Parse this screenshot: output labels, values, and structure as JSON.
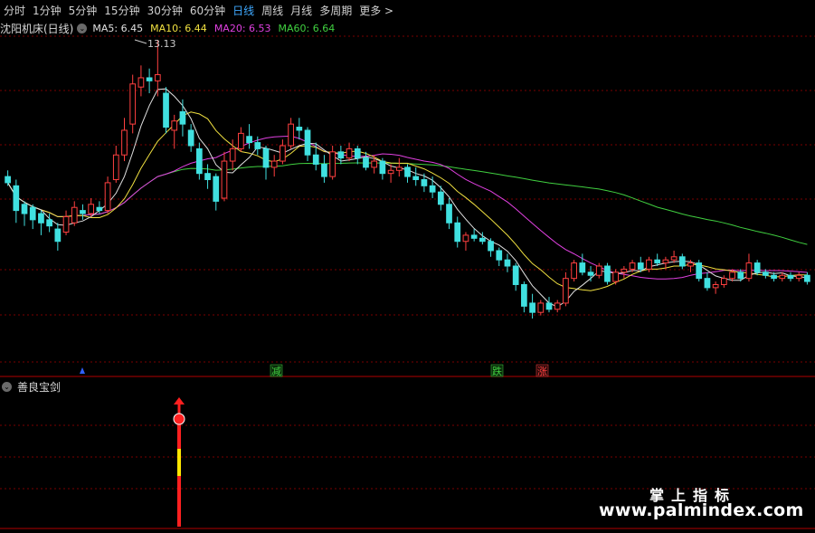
{
  "periods": [
    {
      "label": "分时"
    },
    {
      "label": "1分钟"
    },
    {
      "label": "5分钟"
    },
    {
      "label": "15分钟"
    },
    {
      "label": "30分钟"
    },
    {
      "label": "60分钟"
    },
    {
      "label": "日线"
    },
    {
      "label": "周线"
    },
    {
      "label": "月线"
    },
    {
      "label": "多周期"
    }
  ],
  "active_period": "日线",
  "more_label": "更多 >",
  "stock_title": "沈阳机床(日线)",
  "ma": [
    {
      "label": "MA5: 6.45",
      "color": "#e0e0e0"
    },
    {
      "label": "MA10: 6.44",
      "color": "#f0e040"
    },
    {
      "label": "MA20: 6.53",
      "color": "#e040e0"
    },
    {
      "label": "MA60: 6.64",
      "color": "#40d040"
    }
  ],
  "indicator_title": "善良宝剑",
  "max_price_label": "13.13",
  "signals": [
    {
      "text": "减",
      "color": "#40d040"
    },
    {
      "text": "跌",
      "color": "#40d040"
    },
    {
      "text": "涨",
      "color": "#ff4040"
    }
  ],
  "watermark_cn": "掌上指标",
  "watermark_url": "www.palmindex.com",
  "colors": {
    "up": "#ff4040",
    "down": "#40e0e0",
    "ma5": "#e0e0e0",
    "ma10": "#f0e040",
    "ma20": "#e040e0",
    "ma60": "#40d040",
    "grid": "#7a0000",
    "active": "#3fa9ff"
  },
  "chart_data": {
    "type": "candlestick",
    "ylim": [
      3,
      14
    ],
    "max_label_price": 13.13,
    "ma_last": {
      "MA5": 6.45,
      "MA10": 6.44,
      "MA20": 6.53,
      "MA60": 6.64
    },
    "candles": [
      [
        8.7,
        8.9,
        8.4,
        8.5
      ],
      [
        8.4,
        8.6,
        7.2,
        7.6
      ],
      [
        7.8,
        7.9,
        7.1,
        7.5
      ],
      [
        7.7,
        7.8,
        7.0,
        7.3
      ],
      [
        7.5,
        7.6,
        6.8,
        7.2
      ],
      [
        7.3,
        7.5,
        6.9,
        7.1
      ],
      [
        7.0,
        7.2,
        6.3,
        6.6
      ],
      [
        6.9,
        7.6,
        6.8,
        7.4
      ],
      [
        7.2,
        7.9,
        7.1,
        7.7
      ],
      [
        7.6,
        7.8,
        7.3,
        7.5
      ],
      [
        7.5,
        8.0,
        7.4,
        7.8
      ],
      [
        7.7,
        7.9,
        7.5,
        7.6
      ],
      [
        7.6,
        8.7,
        7.5,
        8.5
      ],
      [
        8.6,
        9.7,
        8.5,
        9.4
      ],
      [
        9.4,
        10.6,
        9.2,
        10.2
      ],
      [
        10.4,
        12.0,
        10.1,
        11.7
      ],
      [
        11.6,
        12.3,
        11.3,
        11.9
      ],
      [
        11.9,
        12.2,
        11.4,
        11.8
      ],
      [
        11.8,
        13.13,
        11.3,
        12.0
      ],
      [
        11.4,
        11.6,
        10.1,
        10.3
      ],
      [
        10.2,
        10.7,
        9.6,
        10.5
      ],
      [
        10.8,
        11.2,
        10.0,
        10.4
      ],
      [
        10.2,
        10.4,
        9.5,
        9.7
      ],
      [
        9.6,
        9.8,
        8.6,
        8.8
      ],
      [
        8.8,
        9.1,
        8.3,
        8.6
      ],
      [
        8.7,
        8.8,
        7.6,
        7.9
      ],
      [
        8.0,
        9.5,
        7.9,
        9.2
      ],
      [
        9.2,
        9.9,
        8.9,
        9.6
      ],
      [
        9.6,
        10.3,
        9.5,
        10.1
      ],
      [
        10.0,
        10.4,
        9.6,
        9.8
      ],
      [
        9.8,
        10.0,
        9.4,
        9.6
      ],
      [
        9.6,
        9.7,
        8.6,
        9.0
      ],
      [
        9.0,
        9.4,
        8.7,
        9.2
      ],
      [
        9.2,
        9.9,
        9.1,
        9.7
      ],
      [
        9.7,
        10.6,
        9.6,
        10.4
      ],
      [
        10.3,
        10.6,
        9.9,
        10.2
      ],
      [
        10.2,
        10.3,
        9.2,
        9.4
      ],
      [
        9.4,
        9.8,
        8.9,
        9.1
      ],
      [
        9.1,
        9.4,
        8.5,
        8.7
      ],
      [
        8.7,
        9.7,
        8.6,
        9.5
      ],
      [
        9.5,
        9.7,
        9.1,
        9.3
      ],
      [
        9.3,
        9.8,
        9.2,
        9.6
      ],
      [
        9.6,
        9.7,
        9.1,
        9.3
      ],
      [
        9.3,
        9.5,
        8.9,
        9.0
      ],
      [
        9.0,
        9.4,
        8.8,
        9.2
      ],
      [
        9.2,
        9.3,
        8.6,
        8.8
      ],
      [
        8.8,
        9.1,
        8.5,
        8.9
      ],
      [
        8.9,
        9.3,
        8.7,
        9.0
      ],
      [
        9.0,
        9.1,
        8.5,
        8.7
      ],
      [
        8.7,
        9.0,
        8.4,
        8.6
      ],
      [
        8.6,
        8.8,
        8.2,
        8.4
      ],
      [
        8.4,
        8.7,
        8.0,
        8.2
      ],
      [
        8.2,
        8.4,
        7.6,
        7.8
      ],
      [
        7.8,
        8.0,
        7.0,
        7.2
      ],
      [
        7.2,
        7.4,
        6.4,
        6.6
      ],
      [
        6.6,
        6.9,
        6.3,
        6.8
      ],
      [
        6.8,
        7.0,
        6.6,
        6.7
      ],
      [
        6.7,
        6.9,
        6.5,
        6.6
      ],
      [
        6.6,
        6.7,
        6.1,
        6.3
      ],
      [
        6.3,
        6.4,
        5.8,
        6.0
      ],
      [
        6.0,
        6.2,
        5.6,
        5.8
      ],
      [
        5.8,
        5.9,
        5.0,
        5.2
      ],
      [
        5.2,
        5.3,
        4.3,
        4.5
      ],
      [
        4.6,
        4.9,
        4.1,
        4.3
      ],
      [
        4.3,
        4.7,
        4.2,
        4.6
      ],
      [
        4.6,
        4.8,
        4.3,
        4.4
      ],
      [
        4.4,
        4.7,
        4.3,
        4.6
      ],
      [
        4.6,
        5.6,
        4.5,
        5.4
      ],
      [
        5.4,
        6.0,
        5.3,
        5.9
      ],
      [
        5.9,
        6.2,
        5.5,
        5.6
      ],
      [
        5.6,
        5.8,
        5.3,
        5.5
      ],
      [
        5.5,
        5.9,
        5.4,
        5.8
      ],
      [
        5.8,
        5.9,
        5.2,
        5.3
      ],
      [
        5.3,
        5.7,
        5.2,
        5.6
      ],
      [
        5.6,
        5.8,
        5.4,
        5.7
      ],
      [
        5.7,
        6.0,
        5.6,
        5.9
      ],
      [
        5.9,
        6.1,
        5.6,
        5.7
      ],
      [
        5.7,
        6.1,
        5.6,
        6.0
      ],
      [
        6.0,
        6.2,
        5.8,
        5.9
      ],
      [
        5.9,
        6.1,
        5.7,
        6.0
      ],
      [
        6.0,
        6.3,
        5.9,
        6.1
      ],
      [
        6.1,
        6.2,
        5.7,
        5.8
      ],
      [
        5.8,
        6.0,
        5.6,
        5.9
      ],
      [
        5.9,
        6.0,
        5.3,
        5.4
      ],
      [
        5.4,
        5.6,
        5.0,
        5.1
      ],
      [
        5.1,
        5.3,
        4.9,
        5.2
      ],
      [
        5.2,
        5.5,
        5.1,
        5.4
      ],
      [
        5.4,
        5.7,
        5.3,
        5.6
      ],
      [
        5.6,
        5.7,
        5.3,
        5.4
      ],
      [
        5.4,
        6.2,
        5.3,
        5.9
      ],
      [
        5.9,
        6.0,
        5.5,
        5.6
      ],
      [
        5.6,
        5.7,
        5.4,
        5.5
      ],
      [
        5.5,
        5.6,
        5.3,
        5.4
      ],
      [
        5.4,
        5.6,
        5.3,
        5.5
      ],
      [
        5.5,
        5.6,
        5.3,
        5.4
      ],
      [
        5.4,
        5.6,
        5.3,
        5.5
      ],
      [
        5.5,
        5.6,
        5.2,
        5.3
      ]
    ]
  }
}
